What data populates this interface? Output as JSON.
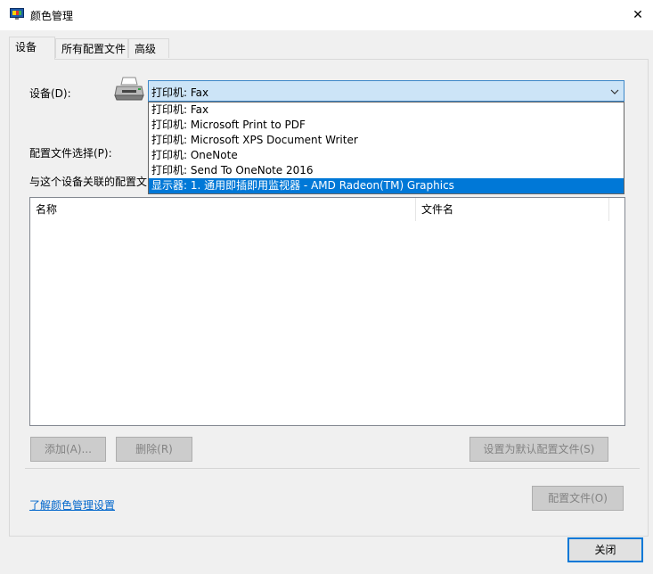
{
  "window": {
    "title": "颜色管理",
    "close_glyph": "✕"
  },
  "tabs": [
    {
      "label": "设备",
      "active": true
    },
    {
      "label": "所有配置文件",
      "active": false
    },
    {
      "label": "高级",
      "active": false
    }
  ],
  "device": {
    "label": "设备(D):",
    "selected": "打印机: Fax",
    "options": [
      "打印机: Fax",
      "打印机: Microsoft Print to PDF",
      "打印机: Microsoft XPS Document Writer",
      "打印机: OneNote",
      "打印机: Send To OneNote 2016",
      "显示器: 1. 通用即插即用监视器 - AMD Radeon(TM) Graphics"
    ],
    "highlighted_index": 5
  },
  "profile_selection": {
    "label": "配置文件选择(P):"
  },
  "associated": {
    "label": "与这个设备关联的配置文"
  },
  "table": {
    "columns": [
      "名称",
      "文件名"
    ]
  },
  "buttons": {
    "add": "添加(A)...",
    "remove": "删除(R)",
    "set_default": "设置为默认配置文件(S)",
    "profiles": "配置文件(O)",
    "close": "关闭"
  },
  "link": {
    "text": "了解颜色管理设置"
  },
  "colors": {
    "accent": "#0078d7",
    "combo_bg": "#cce4f7",
    "link": "#0066cc"
  },
  "icons": {
    "app": "monitor-color-icon",
    "device": "printer-icon",
    "combo": "chevron-down-icon"
  }
}
